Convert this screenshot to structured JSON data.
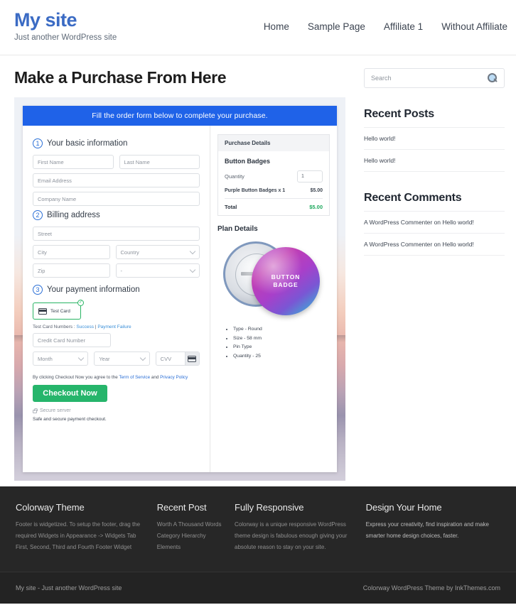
{
  "header": {
    "site_title": "My site",
    "tagline": "Just another WordPress site",
    "nav": [
      {
        "label": "Home"
      },
      {
        "label": "Sample Page"
      },
      {
        "label": "Affiliate 1"
      },
      {
        "label": "Without Affiliate"
      }
    ]
  },
  "main": {
    "page_title": "Make a Purchase From Here",
    "banner": "Fill the order form below to complete your purchase.",
    "steps": {
      "one": {
        "num": "1",
        "label": "Your basic information"
      },
      "two": {
        "num": "2",
        "label": "Billing address"
      },
      "three": {
        "num": "3",
        "label": "Your payment information"
      }
    },
    "fields": {
      "first_name": "First Name",
      "last_name": "Last Name",
      "email": "Email Address",
      "company": "Company Name",
      "street": "Street",
      "city": "City",
      "country": "Country",
      "zip": "Zip",
      "state": "-",
      "card_number": "Credit Card Number",
      "month": "Month",
      "year": "Year",
      "cvv": "CVV"
    },
    "payment": {
      "test_card_label": "Test Card",
      "test_numbers_prefix": "Test Card Numbers : ",
      "test_success": "Success",
      "test_separator": " | ",
      "test_failure": "Payment Failure",
      "agree_prefix": "By clicking Checkout Now you agree to the ",
      "terms": "Term of Service",
      "agree_and": " and ",
      "privacy": "Privacy Policy",
      "checkout_button": "Checkout Now",
      "secure_server": "Secure server",
      "safe_note": "Safe and secure payment checkout."
    },
    "purchase_details": {
      "heading": "Purchase Details",
      "product": "Button Badges",
      "quantity_label": "Quantity",
      "quantity_value": "1",
      "line_item": "Purple Button Badges x 1",
      "line_price": "$5.00",
      "total_label": "Total",
      "total_price": "$5.00"
    },
    "plan": {
      "heading": "Plan Details",
      "badge_line1": "BUTTON",
      "badge_line2": "BADGE",
      "features": [
        "Type - Round",
        "Size - 58 mm",
        "Pin Type",
        "Quantity - 25"
      ]
    }
  },
  "sidebar": {
    "search_placeholder": "Search",
    "recent_posts_title": "Recent Posts",
    "recent_posts": [
      "Hello world!",
      "Hello world!"
    ],
    "recent_comments_title": "Recent Comments",
    "recent_comments": [
      "A WordPress Commenter on Hello world!",
      "A WordPress Commenter on Hello world!"
    ]
  },
  "footer": {
    "columns": [
      {
        "title": "Colorway Theme",
        "text": "Footer is widgetized. To setup the footer, drag the required Widgets in Appearance -> Widgets Tab First, Second, Third and Fourth Footer Widget"
      },
      {
        "title": "Recent Post",
        "items": [
          "Worth A Thousand Words",
          "Category Hierarchy",
          "Elements"
        ]
      },
      {
        "title": "Fully Responsive",
        "text": "Colorway is a unique responsive WordPress theme design is fabulous enough giving your absolute reason to stay on your site."
      },
      {
        "title": "Design Your Home",
        "text": "Express your creativity, find inspiration and make smarter home design choices, faster."
      }
    ],
    "copyright_left": "My site - Just another WordPress site",
    "copyright_right": "Colorway WordPress Theme by InkThemes.com"
  },
  "colors": {
    "brand_blue": "#3b6bc4",
    "banner_blue": "#1f62e8",
    "checkout_green": "#26b56b",
    "total_green": "#1fa95e",
    "footer_dark": "#272727"
  }
}
